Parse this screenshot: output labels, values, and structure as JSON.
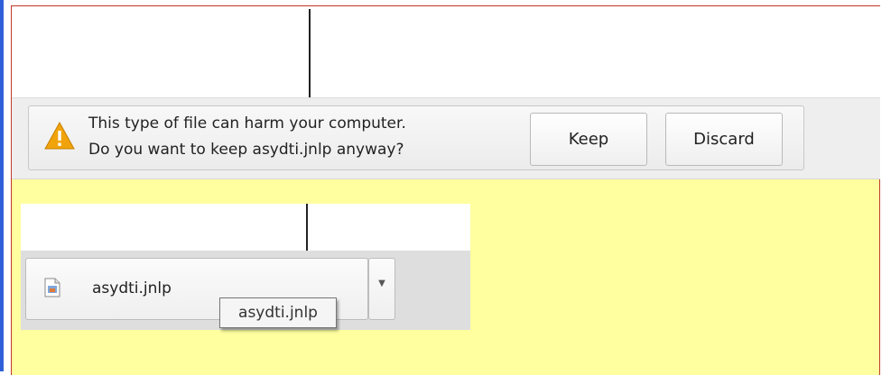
{
  "warning_bar": {
    "line1": "This type of file can harm your computer.",
    "line2": "Do you want to keep asydti.jnlp anyway?",
    "keep_label": "Keep",
    "discard_label": "Discard",
    "icon": "warning-triangle-icon",
    "icon_color": "#f0a30a"
  },
  "download_shelf": {
    "file_name": "asydti.jnlp",
    "tooltip": "asydti.jnlp",
    "file_icon": "jnlp-file-icon",
    "menu_icon": "chevron-down-icon"
  },
  "colors": {
    "background_yellow": "#ffff9f",
    "frame_red": "#c0392b",
    "edge_blue": "#2f5fd8"
  }
}
